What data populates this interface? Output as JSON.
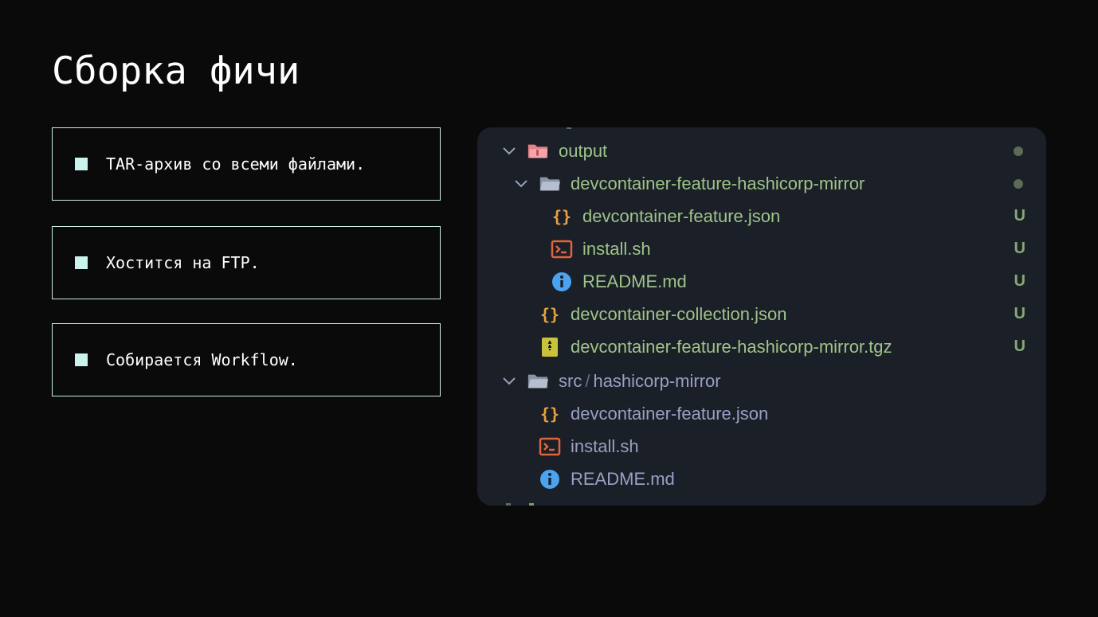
{
  "slide": {
    "title": "Сборка фичи"
  },
  "bullets": [
    {
      "text": "TAR-архив со всеми файлами."
    },
    {
      "text": "Хостится на FTP."
    },
    {
      "text": "Собирается Workflow."
    }
  ],
  "explorer": {
    "rows": [
      {
        "label": "output",
        "icon": "folder-open-red-icon",
        "status": "dot",
        "color": "#9ec488"
      },
      {
        "label": "devcontainer-feature-hashicorp-mirror",
        "icon": "folder-open-icon",
        "status": "dot",
        "color": "#9ec488"
      },
      {
        "label": "devcontainer-feature.json",
        "icon": "json-braces-icon",
        "status": "U",
        "color": "#9ec488"
      },
      {
        "label": "install.sh",
        "icon": "terminal-icon",
        "status": "U",
        "color": "#9ec488"
      },
      {
        "label": "README.md",
        "icon": "info-icon",
        "status": "U",
        "color": "#9ec488"
      },
      {
        "label": "devcontainer-collection.json",
        "icon": "json-braces-icon",
        "status": "U",
        "color": "#9ec488"
      },
      {
        "label": "devcontainer-feature-hashicorp-mirror.tgz",
        "icon": "archive-icon",
        "status": "U",
        "color": "#9ec488"
      },
      {
        "label_parts": [
          "src",
          "/",
          "hashicorp-mirror"
        ],
        "icon": "folder-open-icon",
        "status": "",
        "color": "#9aa0c3"
      },
      {
        "label": "devcontainer-feature.json",
        "icon": "json-braces-icon",
        "status": "",
        "color": "#9aa0c3"
      },
      {
        "label": "install.sh",
        "icon": "terminal-icon",
        "status": "",
        "color": "#9aa0c3"
      },
      {
        "label": "README.md",
        "icon": "info-icon",
        "status": "",
        "color": "#9aa0c3"
      }
    ]
  },
  "colors": {
    "background": "#0a0a0b",
    "bullet_border": "#c9efe6",
    "bullet_square": "#c9f3ec",
    "panel": "#1b1f28",
    "git_untracked": "#9ec488",
    "plain_text": "#9aa0c3",
    "json_icon": "#e8a33d",
    "terminal_icon": "#e0663a",
    "info_icon": "#4aa3f0",
    "archive_icon": "#c8c33a",
    "folder_red": "#e98288"
  }
}
